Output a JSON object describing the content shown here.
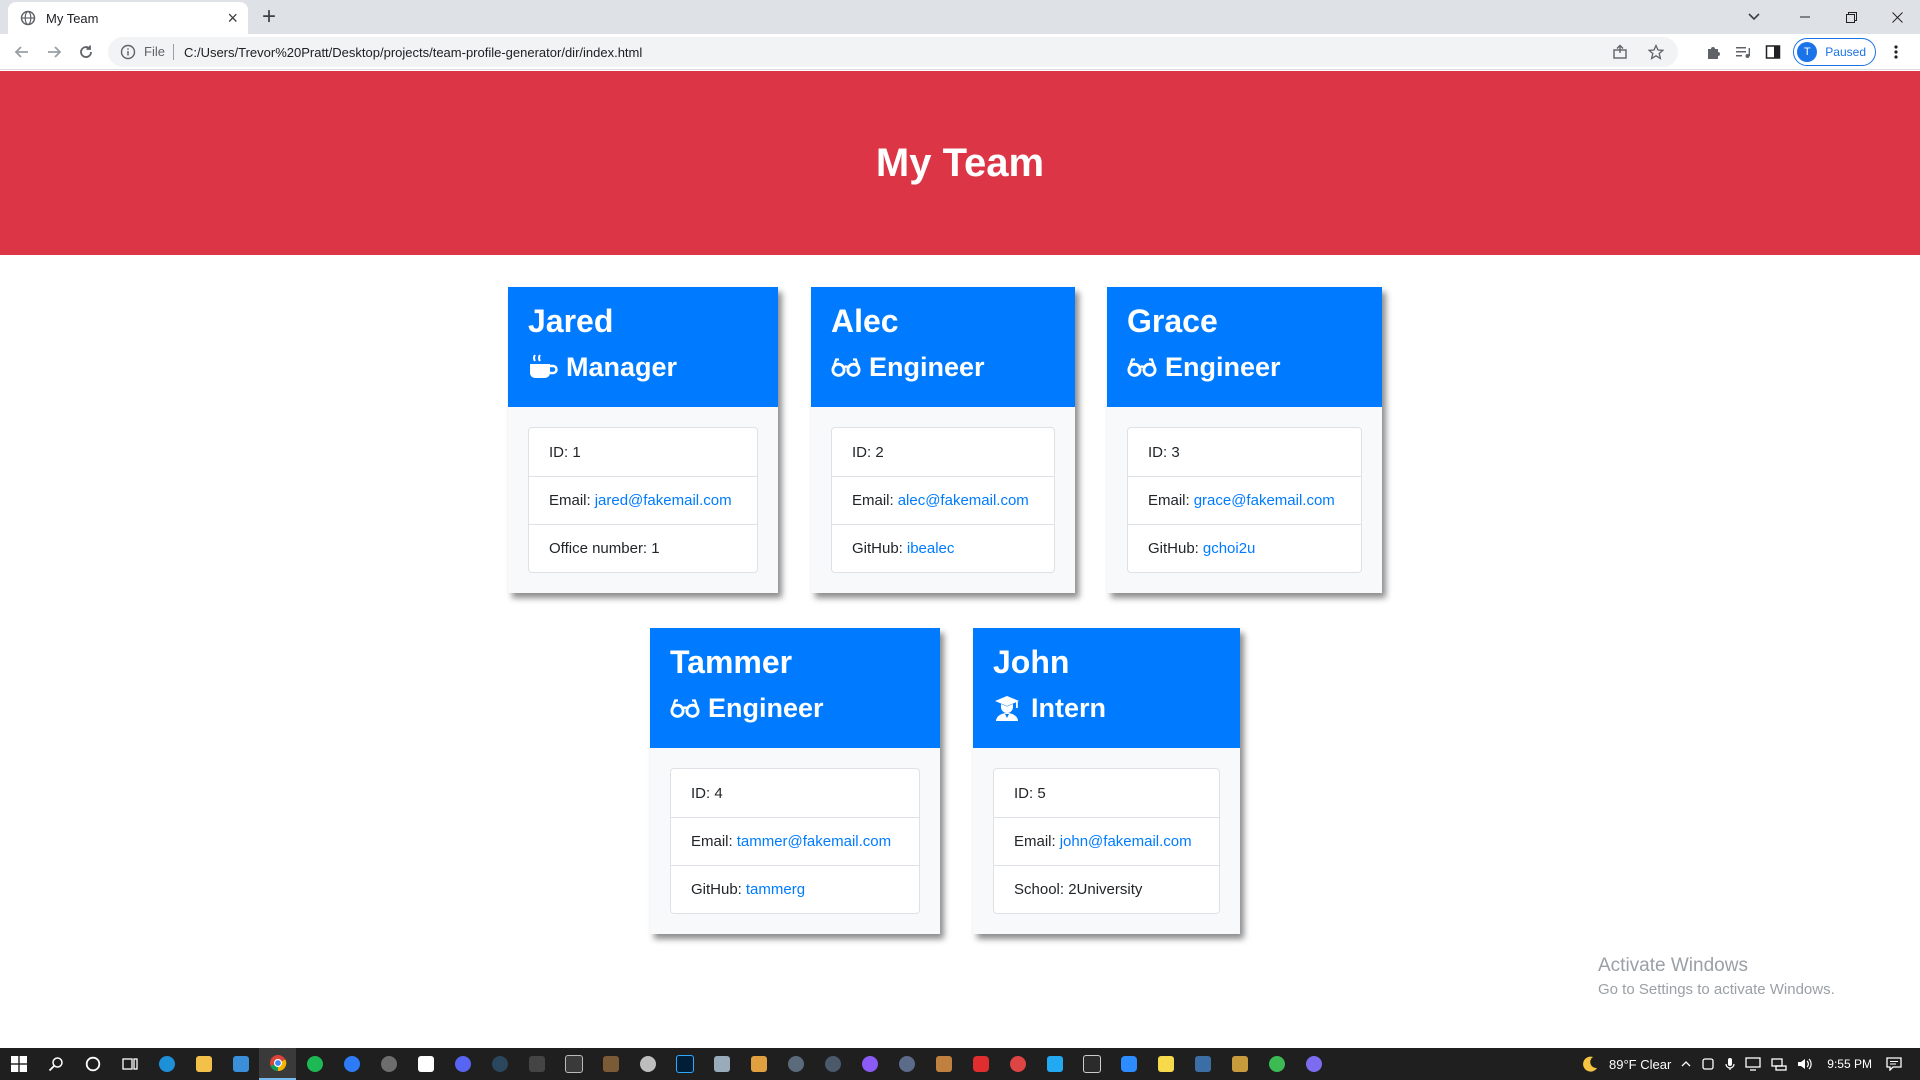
{
  "browser": {
    "tab_title": "My Team",
    "omnibox_scheme": "File",
    "url": "C:/Users/Trevor%20Pratt/Desktop/projects/team-profile-generator/dir/index.html",
    "profile_initial": "T",
    "profile_status": "Paused"
  },
  "page": {
    "title": "My Team",
    "team": [
      {
        "name": "Jared",
        "role": "Manager",
        "role_icon": "coffee-mug-icon",
        "id_text": "ID: 1",
        "email_label": "Email:",
        "email": "jared@fakemail.com",
        "extra_label": "Office number: 1",
        "extra_link": ""
      },
      {
        "name": "Alec",
        "role": "Engineer",
        "role_icon": "glasses-icon",
        "id_text": "ID: 2",
        "email_label": "Email:",
        "email": "alec@fakemail.com",
        "extra_label": "GitHub:",
        "extra_link": "ibealec"
      },
      {
        "name": "Grace",
        "role": "Engineer",
        "role_icon": "glasses-icon",
        "id_text": "ID: 3",
        "email_label": "Email:",
        "email": "grace@fakemail.com",
        "extra_label": "GitHub:",
        "extra_link": "gchoi2u"
      },
      {
        "name": "Tammer",
        "role": "Engineer",
        "role_icon": "glasses-icon",
        "id_text": "ID: 4",
        "email_label": "Email:",
        "email": "tammer@fakemail.com",
        "extra_label": "GitHub:",
        "extra_link": "tammerg"
      },
      {
        "name": "John",
        "role": "Intern",
        "role_icon": "graduate-icon",
        "id_text": "ID: 5",
        "email_label": "Email:",
        "email": "john@fakemail.com",
        "extra_label": "School: 2University",
        "extra_link": ""
      }
    ]
  },
  "watermark": {
    "title": "Activate Windows",
    "subtitle": "Go to Settings to activate Windows."
  },
  "taskbar": {
    "weather": "89°F  Clear",
    "time": "9:55 PM"
  },
  "colors": {
    "header_bg": "#dc3545",
    "card_head_bg": "#007bff",
    "link": "#007bff"
  }
}
